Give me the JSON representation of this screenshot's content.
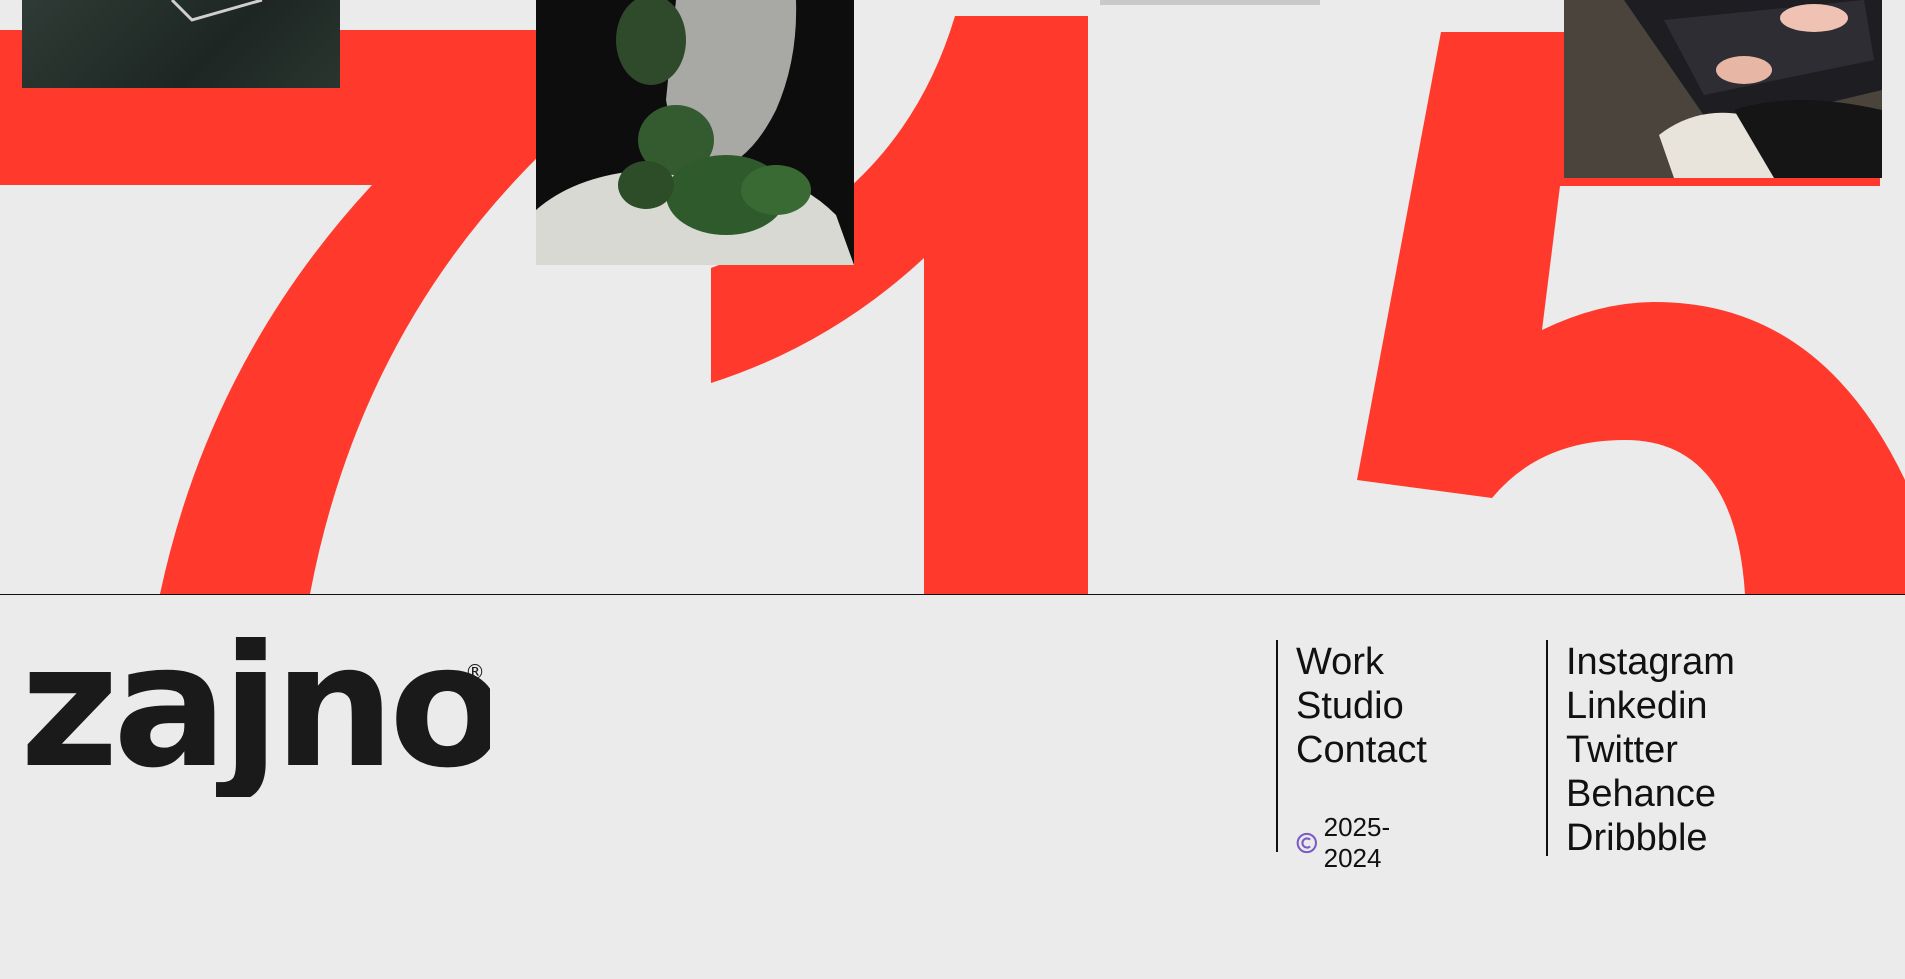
{
  "colors": {
    "accent": "#ff3a2d",
    "background": "#ebebeb",
    "text": "#111111",
    "copyright_icon": "#7a5cc4"
  },
  "hero": {
    "digits": [
      "7",
      "1",
      "5"
    ]
  },
  "brand": {
    "name": "zajno",
    "registered_mark": "®"
  },
  "footer": {
    "nav": [
      {
        "label": "Work"
      },
      {
        "label": "Studio"
      },
      {
        "label": "Contact"
      }
    ],
    "copyright": {
      "icon": "copyright-icon",
      "text": "2025-2024"
    },
    "social": [
      {
        "label": "Instagram"
      },
      {
        "label": "Linkedin"
      },
      {
        "label": "Twitter"
      },
      {
        "label": "Behance"
      },
      {
        "label": "Dribbble"
      }
    ]
  }
}
